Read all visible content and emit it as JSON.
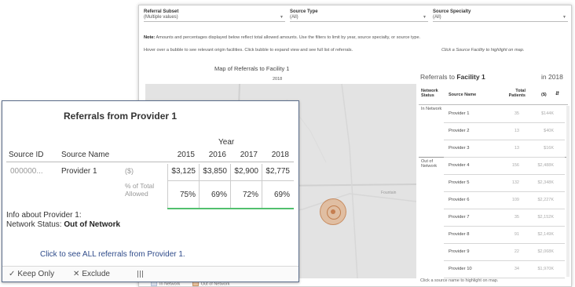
{
  "filters": [
    {
      "label": "Referral Subset",
      "value": "(Multiple values)"
    },
    {
      "label": "Source Type",
      "value": "(All)"
    },
    {
      "label": "Source Specialty",
      "value": "(All)"
    }
  ],
  "note": {
    "bold": "Note:",
    "text": "Amounts and percentages displayed below reflect total allowed amounts. Use the filters to limit by year, source specialty, or source type."
  },
  "hint_left": "Hover over a bubble to see relevant origin facilities. Click bubble to expand view and see full list of referrals.",
  "hint_right": "Click a Source Facility to highlight on map.",
  "map": {
    "title": "Map of Referrals to Facility 1",
    "year": "2018",
    "place_label": "Fountain"
  },
  "legend": {
    "in": "In Network",
    "out": "Out of Network"
  },
  "referrals_table": {
    "title_prefix": "Referrals to",
    "title_facility": "Facility 1",
    "year": "in 2018",
    "col_status": "Network Status",
    "col_name": "Source Name",
    "col_patients": "Total Patients",
    "col_amount": "($)",
    "groups": [
      "In Network",
      "Out of Network"
    ],
    "rows": [
      {
        "name": "Provider 1",
        "patients": "35",
        "amount": "$144K"
      },
      {
        "name": "Provider 2",
        "patients": "13",
        "amount": "$40K"
      },
      {
        "name": "Provider 3",
        "patients": "13",
        "amount": "$16K"
      },
      {
        "name": "Provider 4",
        "patients": "156",
        "amount": "$2,488K"
      },
      {
        "name": "Provider 5",
        "patients": "132",
        "amount": "$2,348K"
      },
      {
        "name": "Provider 6",
        "patients": "109",
        "amount": "$2,227K"
      },
      {
        "name": "Provider 7",
        "patients": "35",
        "amount": "$2,152K"
      },
      {
        "name": "Provider 8",
        "patients": "91",
        "amount": "$2,149K"
      },
      {
        "name": "Provider 9",
        "patients": "22",
        "amount": "$2,068K"
      },
      {
        "name": "Provider 10",
        "patients": "34",
        "amount": "$1,970K"
      }
    ],
    "footer": "Click a source name to highlight on map."
  },
  "tooltip": {
    "title": "Referrals from Provider 1",
    "year_header": "Year",
    "col_id": "Source ID",
    "col_name": "Source Name",
    "years": [
      "2015",
      "2016",
      "2017",
      "2018"
    ],
    "source_id": "000000...",
    "source_name": "Provider 1",
    "row1_label": "($)",
    "row1_values": [
      "$3,125",
      "$3,850",
      "$2,900",
      "$2,775"
    ],
    "row2_label": "% of Total Allowed",
    "row2_values": [
      "75%",
      "69%",
      "72%",
      "69%"
    ],
    "info_line": "Info about  Provider 1:",
    "status_label": "Network Status:",
    "status_value": "Out of Network",
    "link": "Click to see ALL referrals from Provider 1.",
    "keep_only": "Keep Only",
    "exclude": "Exclude"
  }
}
